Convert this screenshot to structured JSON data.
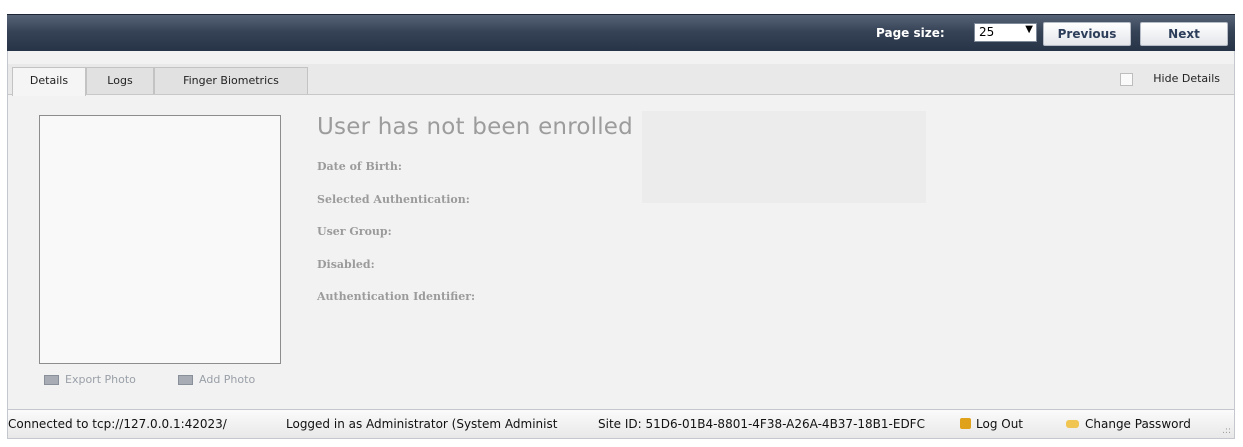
{
  "toolbar": {
    "page_size_label": "Page size:",
    "page_size_value": "25",
    "previous_label": "Previous",
    "next_label": "Next",
    "header_color": "#364256"
  },
  "tabs": [
    {
      "label": "Details",
      "active": true
    },
    {
      "label": "Logs",
      "active": false
    },
    {
      "label": "Finger Biometrics",
      "active": false
    }
  ],
  "hide_details": {
    "label": "Hide Details",
    "checked": false
  },
  "details": {
    "headline": "User has not been enrolled",
    "fields": [
      "Date of Birth:",
      "Selected Authentication:",
      "User Group:",
      "Disabled:",
      "Authentication Identifier:"
    ],
    "photo_actions": {
      "export_label": "Export Photo",
      "add_label": "Add Photo",
      "export_icon": "export-photo-icon",
      "add_icon": "add-photo-icon"
    }
  },
  "status_bar": {
    "connection": "Connected to tcp://127.0.0.1:42023/",
    "login": "Logged in as Administrator (System Administ",
    "site_id": "Site ID: 51D6-01B4-8801-4F38-A26A-4B37-18B1-EDFC",
    "logout_label": "Log Out",
    "change_password_label": "Change Password",
    "logout_icon": "lock-icon",
    "change_password_icon": "key-icon"
  }
}
